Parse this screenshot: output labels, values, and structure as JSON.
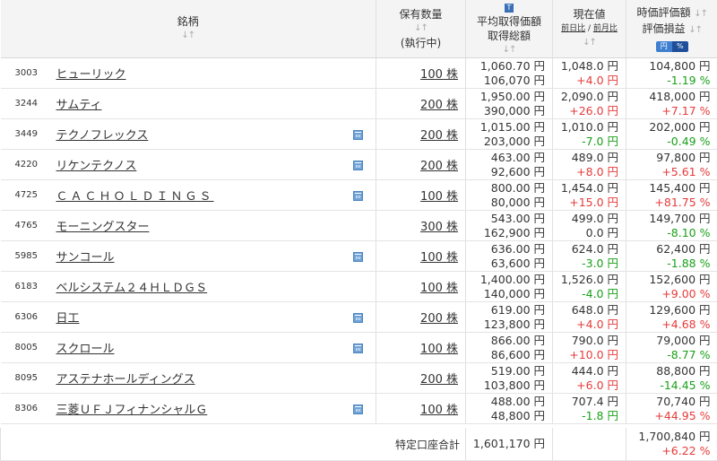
{
  "header": {
    "name": "銘柄",
    "qty_line1": "保有数量",
    "qty_line2": "(執行中)",
    "avg_line1": "平均取得価額",
    "avg_line2": "取得総額",
    "cur_line1": "現在値",
    "cur_prev_day": "前日比",
    "cur_sep": "/",
    "cur_prev_month": "前月比",
    "val_line1": "時価評価額",
    "val_line2": "評価損益",
    "toggle_yen": "円",
    "toggle_pct": "%",
    "sort_glyph": "↓↑",
    "info_glyph": "T"
  },
  "rows": [
    {
      "code": "3003",
      "name": "ヒューリック",
      "calendar": false,
      "qty": "100 株",
      "avg": "1,060.70 円",
      "total": "106,070 円",
      "cur": "1,048.0 円",
      "chg": "+4.0 円",
      "chg_sign": "pos",
      "val": "104,800 円",
      "pl": "-1.19 %",
      "pl_sign": "neg"
    },
    {
      "code": "3244",
      "name": "サムティ",
      "calendar": false,
      "qty": "200 株",
      "avg": "1,950.00 円",
      "total": "390,000 円",
      "cur": "2,090.0 円",
      "chg": "+26.0 円",
      "chg_sign": "pos",
      "val": "418,000 円",
      "pl": "+7.17 %",
      "pl_sign": "pos"
    },
    {
      "code": "3449",
      "name": "テクノフレックス",
      "calendar": true,
      "qty": "200 株",
      "avg": "1,015.00 円",
      "total": "203,000 円",
      "cur": "1,010.0 円",
      "chg": "-7.0 円",
      "chg_sign": "neg",
      "val": "202,000 円",
      "pl": "-0.49 %",
      "pl_sign": "neg"
    },
    {
      "code": "4220",
      "name": "リケンテクノス",
      "calendar": true,
      "qty": "200 株",
      "avg": "463.00 円",
      "total": "92,600 円",
      "cur": "489.0 円",
      "chg": "+8.0 円",
      "chg_sign": "pos",
      "val": "97,800 円",
      "pl": "+5.61 %",
      "pl_sign": "pos"
    },
    {
      "code": "4725",
      "name": "ＣＡＣＨＯＬＤＩＮＧＳ",
      "calendar": true,
      "qty": "100 株",
      "avg": "800.00 円",
      "total": "80,000 円",
      "cur": "1,454.0 円",
      "chg": "+15.0 円",
      "chg_sign": "pos",
      "val": "145,400 円",
      "pl": "+81.75 %",
      "pl_sign": "pos"
    },
    {
      "code": "4765",
      "name": "モーニングスター",
      "calendar": false,
      "qty": "300 株",
      "avg": "543.00 円",
      "total": "162,900 円",
      "cur": "499.0 円",
      "chg": "0.0 円",
      "chg_sign": "zero",
      "val": "149,700 円",
      "pl": "-8.10 %",
      "pl_sign": "neg"
    },
    {
      "code": "5985",
      "name": "サンコール",
      "calendar": true,
      "qty": "100 株",
      "avg": "636.00 円",
      "total": "63,600 円",
      "cur": "624.0 円",
      "chg": "-3.0 円",
      "chg_sign": "neg",
      "val": "62,400 円",
      "pl": "-1.88 %",
      "pl_sign": "neg"
    },
    {
      "code": "6183",
      "name": "ベルシステム２４ＨＬＤＧＳ",
      "calendar": false,
      "qty": "100 株",
      "avg": "1,400.00 円",
      "total": "140,000 円",
      "cur": "1,526.0 円",
      "chg": "-4.0 円",
      "chg_sign": "neg",
      "val": "152,600 円",
      "pl": "+9.00 %",
      "pl_sign": "pos"
    },
    {
      "code": "6306",
      "name": "日工",
      "calendar": true,
      "qty": "200 株",
      "avg": "619.00 円",
      "total": "123,800 円",
      "cur": "648.0 円",
      "chg": "+4.0 円",
      "chg_sign": "pos",
      "val": "129,600 円",
      "pl": "+4.68 %",
      "pl_sign": "pos"
    },
    {
      "code": "8005",
      "name": "スクロール",
      "calendar": true,
      "qty": "100 株",
      "avg": "866.00 円",
      "total": "86,600 円",
      "cur": "790.0 円",
      "chg": "+10.0 円",
      "chg_sign": "pos",
      "val": "79,000 円",
      "pl": "-8.77 %",
      "pl_sign": "neg"
    },
    {
      "code": "8095",
      "name": "アステナホールディングス",
      "calendar": false,
      "qty": "200 株",
      "avg": "519.00 円",
      "total": "103,800 円",
      "cur": "444.0 円",
      "chg": "+6.0 円",
      "chg_sign": "pos",
      "val": "88,800 円",
      "pl": "-14.45 %",
      "pl_sign": "neg"
    },
    {
      "code": "8306",
      "name": "三菱ＵＦＪフィナンシャルＧ",
      "calendar": true,
      "qty": "100 株",
      "avg": "488.00 円",
      "total": "48,800 円",
      "cur": "707.4 円",
      "chg": "-1.8 円",
      "chg_sign": "neg",
      "val": "70,740 円",
      "pl": "+44.95 %",
      "pl_sign": "pos"
    }
  ],
  "footer": {
    "label": "特定口座合計",
    "total_cost": "1,601,170 円",
    "total_value": "1,700,840 円",
    "total_pl": "+6.22 %"
  },
  "colors": {
    "positive": "#e63b3b",
    "negative": "#1aa01a",
    "header_bg": "#f4f4f4"
  }
}
